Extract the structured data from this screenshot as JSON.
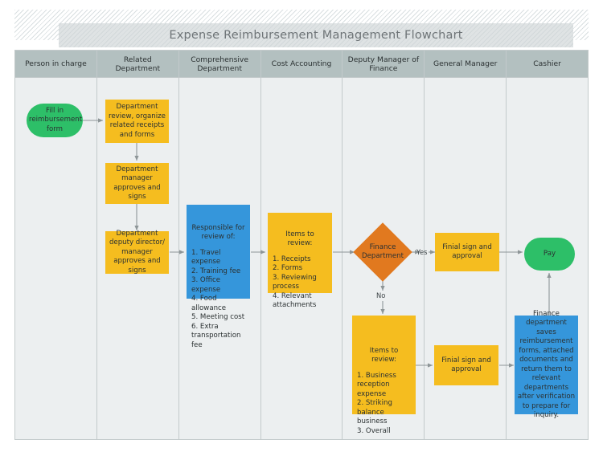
{
  "title": "Expense Reimbursement Management Flowchart",
  "lanes": [
    {
      "label": "Person in charge"
    },
    {
      "label": "Related Department"
    },
    {
      "label": "Comprehensive Department"
    },
    {
      "label": "Cost Accounting"
    },
    {
      "label": "Deputy Manager of Finance"
    },
    {
      "label": "General Manager"
    },
    {
      "label": "Cashier"
    }
  ],
  "nodes": {
    "start_fill_form": "Fill in reimbursement form",
    "dept_review": "Department review, organize related receipts and forms",
    "dept_manager_approve": "Department manager approves and signs",
    "dept_deputy_approve": "Department deputy director/ manager approves and signs",
    "responsible_title": "Responsible for review of:",
    "responsible_items": "1. Travel expense\n2. Training fee\n3. Office expense\n4. Food allowance\n5. Meeting cost\n6. Extra transportation fee",
    "cost_items_title": "Items to review:",
    "cost_items_list": "1. Receipts\n2. Forms\n3. Reviewing process\n4. Relevant attachments",
    "finance_decision": "Finance Department",
    "final_sign_top": "Finial sign and approval",
    "pay": "Pay",
    "finance_items_title": "Items to review:",
    "finance_items_list": "1. Business reception expense\n2. Striking balance business\n3. Overall",
    "final_sign_bottom": "Finial sign and approval",
    "cashier_archive": "Finance department saves reimbursement forms, attached documents and return them to relevant departments after verification to prepare for inquiry."
  },
  "edge_labels": {
    "yes": "Yes",
    "no": "No"
  },
  "colors": {
    "process": "#f5bd1f",
    "data": "#3596db",
    "terminator": "#2dbf68",
    "decision": "#e1791f",
    "lane_header": "#b3c0c0",
    "lane_body": "#eceff0",
    "connector": "#8e9698",
    "title_text": "#6e7477"
  }
}
